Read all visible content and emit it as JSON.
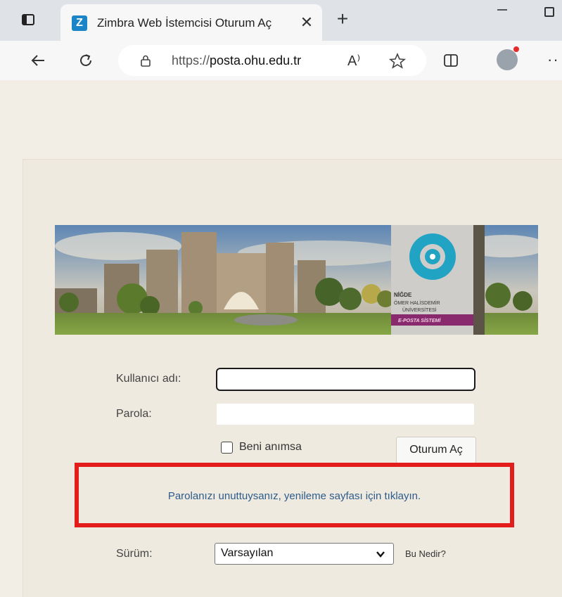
{
  "browser": {
    "tab_title": "Zimbra Web İstemcisi Oturum Aç",
    "tab_favicon_letter": "Z",
    "url_scheme": "https://",
    "url_host": "posta.ohu.edu.tr",
    "read_aloud_label": "A⁾",
    "new_tab_glyph": "+",
    "close_glyph": "✕",
    "more_glyph": "··"
  },
  "banner": {
    "line1": "NİĞDE",
    "line2": "ÖMER HALİSDEMİR",
    "line3": "ÜNİVERSİTESİ",
    "line4": "E-POSTA SİSTEMİ"
  },
  "login": {
    "username_label": "Kullanıcı adı:",
    "username_value": "",
    "password_label": "Parola:",
    "password_value": "",
    "remember_label": "Beni anımsa",
    "remember_checked": false,
    "login_button": "Oturum Aç",
    "forgot_link": "Parolanızı unuttuysanız, yenileme sayfası için tıklayın.",
    "version_label": "Sürüm:",
    "version_value": "Varsayılan",
    "what_link": "Bu Nedir?"
  },
  "colors": {
    "highlight": "#e31c1c",
    "link": "#2d5b8c",
    "favicon": "#1c85c7",
    "page_bg": "#f2eee5"
  },
  "icons": [
    "tab-actions-icon",
    "close-icon",
    "new-tab-icon",
    "minimize-icon",
    "maximize-icon",
    "back-arrow-icon",
    "reload-icon",
    "lock-icon",
    "read-aloud-icon",
    "favorite-star-icon",
    "split-screen-icon",
    "profile-icon",
    "more-icon",
    "chevron-down-icon",
    "university-logo-icon"
  ]
}
